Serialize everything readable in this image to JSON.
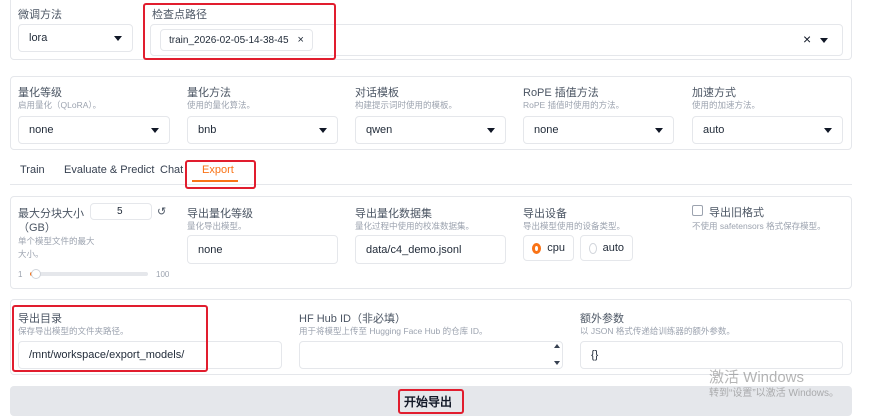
{
  "top": {
    "method_label": "微调方法",
    "method_value": "lora",
    "checkpoint_label": "检查点路径",
    "checkpoint_chip": "train_2026-02-05-14-38-45",
    "chip_remove": "×",
    "clear_glyph": "×"
  },
  "quant_row": [
    {
      "label": "量化等级",
      "sub": "启用量化（QLoRA）。",
      "value": "none"
    },
    {
      "label": "量化方法",
      "sub": "使用的量化算法。",
      "value": "bnb"
    },
    {
      "label": "对话模板",
      "sub": "构建提示词时使用的模板。",
      "value": "qwen"
    },
    {
      "label": "RoPE 插值方法",
      "sub": "RoPE 插值时使用的方法。",
      "value": "none"
    },
    {
      "label": "加速方式",
      "sub": "使用的加速方法。",
      "value": "auto"
    }
  ],
  "tabs": [
    {
      "label": "Train"
    },
    {
      "label": "Evaluate & Predict"
    },
    {
      "label": "Chat"
    },
    {
      "label": "Export"
    }
  ],
  "export": {
    "shard_label": "最大分块大小",
    "shard_label2": "（GB）",
    "shard_value": "5",
    "shard_reset": "↺",
    "shard_sub": "单个模型文件的最大大小。",
    "slider_min": "1",
    "slider_max": "100",
    "slider_value": 1,
    "quant_bit_label": "导出量化等级",
    "quant_bit_sub": "量化导出模型。",
    "quant_bit_value": "none",
    "dataset_label": "导出量化数据集",
    "dataset_sub": "量化过程中使用的校准数据集。",
    "dataset_value": "data/c4_demo.jsonl",
    "device_label": "导出设备",
    "device_sub": "导出模型使用的设备类型。",
    "device_options": [
      "cpu",
      "auto"
    ],
    "device_selected": "cpu",
    "legacy_label": "导出旧格式",
    "legacy_sub": "不使用 safetensors 格式保存模型。"
  },
  "dir_row": {
    "dir_label": "导出目录",
    "dir_sub": "保存导出模型的文件夹路径。",
    "dir_value": "/mnt/workspace/export_models/",
    "hub_label": "HF Hub ID（非必填）",
    "hub_sub": "用于将模型上传至 Hugging Face Hub 的仓库 ID。",
    "hub_value": "",
    "extra_label": "额外参数",
    "extra_sub": "以 JSON 格式传递给训练器的额外参数。",
    "extra_value": "{}"
  },
  "start_button": "开始导出",
  "watermark": {
    "line1": "激活 Windows",
    "line2": "转到“设置”以激活 Windows。"
  },
  "colors": {
    "accent": "#f97316",
    "highlight": "#e11d2e",
    "button_bg": "#e5e7eb"
  }
}
